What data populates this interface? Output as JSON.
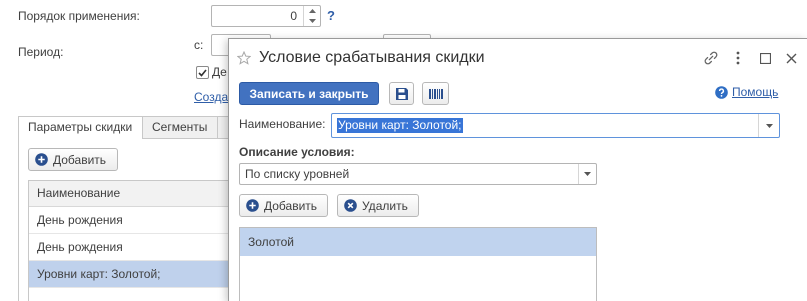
{
  "colors": {
    "accent": "#4272c0",
    "link": "#2f5ea8",
    "selection_row": "#bfd1ec",
    "text_selection": "#3875d7",
    "focus_border": "#5f93dc"
  },
  "icons": {
    "favorite": "star-icon",
    "link": "link-icon",
    "more": "more-icon",
    "maximize": "maximize-icon",
    "close": "close-icon",
    "save": "save-icon",
    "barcode": "barcode-icon",
    "help": "help-icon",
    "add": "plus-circle-icon",
    "delete": "cross-circle-icon",
    "dropdown": "chevron-down-icon"
  },
  "background_form": {
    "order_label": "Порядок применения:",
    "order_value": "0",
    "order_help": "?",
    "period_label": "Период:",
    "period_from_label": "с:",
    "checkbox_label": "Де",
    "checkbox_checked": true,
    "create_link": "Созда",
    "tabs": [
      {
        "label": "Параметры скидки",
        "active": true
      },
      {
        "label": "Сегменты",
        "active": false
      }
    ],
    "add_button": "Добавить",
    "table": {
      "columns": [
        "Наименование"
      ],
      "rows": [
        {
          "name": "День рождения",
          "selected": false
        },
        {
          "name": "День рождения",
          "selected": false
        },
        {
          "name": "Уровни карт: Золотой;",
          "selected": true
        }
      ]
    }
  },
  "dialog": {
    "title": "Условие срабатывания скидки",
    "toolbar": {
      "save_close": "Записать и закрыть",
      "help": "Помощь"
    },
    "name_label": "Наименование:",
    "name_value": "Уровни карт: Золотой;",
    "condition_label": "Описание условия:",
    "condition_value": "По списку уровней",
    "add_button": "Добавить",
    "delete_button": "Удалить",
    "list": {
      "rows": [
        {
          "name": "Золотой",
          "selected": true
        }
      ]
    }
  }
}
